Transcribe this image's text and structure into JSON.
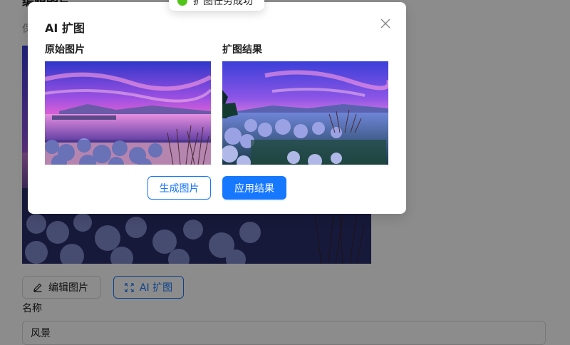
{
  "page": {
    "title": "编辑图片",
    "hint": "保",
    "edit_button_label": "编辑图片",
    "ai_expand_button_label": "AI 扩图",
    "name_label": "名称",
    "name_value": "风景"
  },
  "toast": {
    "text": "扩图任务成功",
    "status_color": "#52c41a"
  },
  "modal": {
    "title": "AI 扩图",
    "original_label": "原始图片",
    "result_label": "扩图结果",
    "generate_button_label": "生成图片",
    "apply_button_label": "应用结果"
  },
  "colors": {
    "primary": "#1677ff"
  },
  "icons": {
    "edit": "pencil-icon",
    "expand": "expand-arrows-icon",
    "close": "close-icon",
    "success": "check-circle-icon"
  }
}
